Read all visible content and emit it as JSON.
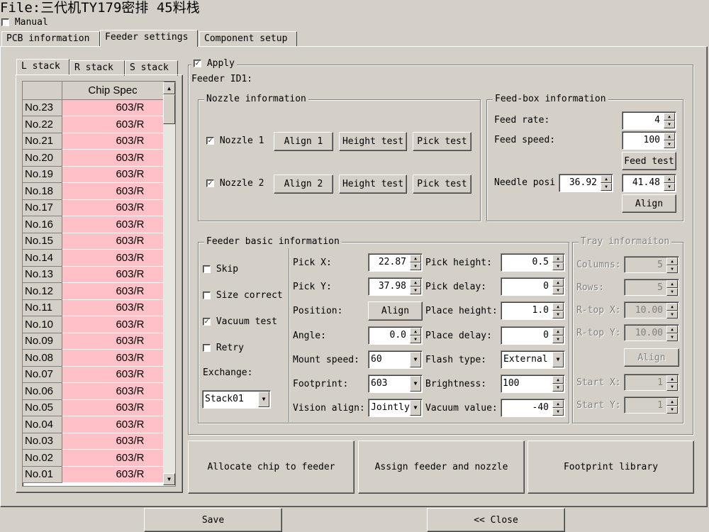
{
  "title": "File:三代机TY179密排  45料栈",
  "manual": {
    "label": "Manual",
    "checked": false
  },
  "main_tabs": [
    "PCB information",
    "Feeder settings",
    "Component setup"
  ],
  "stack_tabs": [
    "L stack",
    "R stack",
    "S stack"
  ],
  "grid": {
    "header": "Chip Spec",
    "rows": [
      {
        "id": "No.23",
        "spec": "603/R"
      },
      {
        "id": "No.22",
        "spec": "603/R"
      },
      {
        "id": "No.21",
        "spec": "603/R"
      },
      {
        "id": "No.20",
        "spec": "603/R"
      },
      {
        "id": "No.19",
        "spec": "603/R"
      },
      {
        "id": "No.18",
        "spec": "603/R"
      },
      {
        "id": "No.17",
        "spec": "603/R"
      },
      {
        "id": "No.16",
        "spec": "603/R"
      },
      {
        "id": "No.15",
        "spec": "603/R"
      },
      {
        "id": "No.14",
        "spec": "603/R"
      },
      {
        "id": "No.13",
        "spec": "603/R"
      },
      {
        "id": "No.12",
        "spec": "603/R"
      },
      {
        "id": "No.11",
        "spec": "603/R"
      },
      {
        "id": "No.10",
        "spec": "603/R"
      },
      {
        "id": "No.09",
        "spec": "603/R"
      },
      {
        "id": "No.08",
        "spec": "603/R"
      },
      {
        "id": "No.07",
        "spec": "603/R"
      },
      {
        "id": "No.06",
        "spec": "603/R"
      },
      {
        "id": "No.05",
        "spec": "603/R"
      },
      {
        "id": "No.04",
        "spec": "603/R"
      },
      {
        "id": "No.03",
        "spec": "603/R"
      },
      {
        "id": "No.02",
        "spec": "603/R"
      },
      {
        "id": "No.01",
        "spec": "603/R"
      }
    ]
  },
  "apply": {
    "label": "Apply",
    "checked": true
  },
  "feeder_id": "Feeder ID1:",
  "nozzle": {
    "title": "Nozzle information",
    "nozzle1": {
      "label": "Nozzle 1",
      "checked": true,
      "align": "Align 1",
      "height": "Height test",
      "pick": "Pick test"
    },
    "nozzle2": {
      "label": "Nozzle 2",
      "checked": true,
      "align": "Align 2",
      "height": "Height test",
      "pick": "Pick test"
    }
  },
  "feedbox": {
    "title": "Feed-box information",
    "feed_rate_label": "Feed rate:",
    "feed_rate": "4",
    "feed_speed_label": "Feed speed:",
    "feed_speed": "100",
    "feed_test": "Feed test",
    "needle_label": "Needle posi",
    "needle_x": "36.92",
    "needle_y": "41.48",
    "align": "Align"
  },
  "basic": {
    "title": "Feeder basic information",
    "skip": {
      "label": "Skip",
      "checked": false
    },
    "size_correct": {
      "label": "Size correct",
      "checked": false
    },
    "vacuum_test": {
      "label": "Vacuum test",
      "checked": true
    },
    "retry": {
      "label": "Retry",
      "checked": false
    },
    "exchange_label": "Exchange:",
    "exchange": "Stack01",
    "pick_x_label": "Pick X:",
    "pick_x": "22.87",
    "pick_y_label": "Pick Y:",
    "pick_y": "37.98",
    "position_label": "Position:",
    "position_btn": "Align",
    "angle_label": "Angle:",
    "angle": "0.0",
    "mount_speed_label": "Mount speed:",
    "mount_speed": "60",
    "footprint_label": "Footprint:",
    "footprint": "603",
    "vision_label": "Vision align:",
    "vision": "Jointly",
    "pick_height_label": "Pick height:",
    "pick_height": "0.5",
    "pick_delay_label": "Pick delay:",
    "pick_delay": "0",
    "place_height_label": "Place height:",
    "place_height": "1.0",
    "place_delay_label": "Place delay:",
    "place_delay": "0",
    "flash_label": "Flash type:",
    "flash": "External",
    "brightness_label": "Brightness:",
    "brightness": "100",
    "vacuum_label": "Vacuum value:",
    "vacuum": "-40"
  },
  "tray": {
    "title": "Tray informaiton",
    "columns_label": "Columns:",
    "columns": "5",
    "rows_label": "Rows:",
    "rows": "5",
    "rtop_x_label": "R-top X:",
    "rtop_x": "10.00",
    "rtop_y_label": "R-top Y:",
    "rtop_y": "10.00",
    "align": "Align",
    "start_x_label": "Start X:",
    "start_x": "1",
    "start_y_label": "Start Y:",
    "start_y": "1"
  },
  "big_buttons": {
    "allocate": "Allocate chip to feeder",
    "assign": "Assign feeder and nozzle",
    "footprint": "Footprint library"
  },
  "footer": {
    "save": "Save",
    "close": "<< Close"
  }
}
